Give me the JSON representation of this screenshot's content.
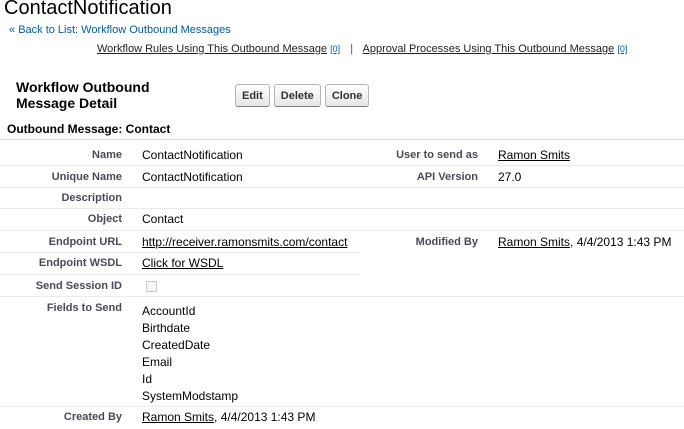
{
  "page": {
    "title": "ContactNotification",
    "back_prefix": "«",
    "back_link": "Back to List: Workflow Outbound Messages"
  },
  "related": {
    "workflow_rules_label": "Workflow Rules Using This Outbound Message",
    "workflow_rules_count": "[0]",
    "separator": "|",
    "approval_label": "Approval Processes Using This Outbound Message",
    "approval_count": "[0]"
  },
  "detail": {
    "header": "Workflow Outbound Message Detail",
    "buttons": {
      "edit": "Edit",
      "delete": "Delete",
      "clone": "Clone"
    },
    "section_title": "Outbound Message: Contact"
  },
  "fields": {
    "name_label": "Name",
    "name_value": "ContactNotification",
    "unique_name_label": "Unique Name",
    "unique_name_value": "ContactNotification",
    "description_label": "Description",
    "description_value": "",
    "object_label": "Object",
    "object_value": "Contact",
    "endpoint_url_label": "Endpoint URL",
    "endpoint_url_value": "http://receiver.ramonsmits.com/contact",
    "endpoint_wsdl_label": "Endpoint WSDL",
    "endpoint_wsdl_value": "Click for WSDL",
    "send_session_id_label": "Send Session ID",
    "send_session_id_checked": false,
    "fields_to_send_label": "Fields to Send",
    "fields_to_send": [
      "AccountId",
      "Birthdate",
      "CreatedDate",
      "Email",
      "Id",
      "SystemModstamp"
    ],
    "created_by_label": "Created By",
    "created_by_user": "Ramon Smits",
    "created_by_date": ", 4/4/2013 1:43 PM",
    "user_to_send_as_label": "User to send as",
    "user_to_send_as_value": "Ramon Smits",
    "api_version_label": "API Version",
    "api_version_value": "27.0",
    "modified_by_label": "Modified By",
    "modified_by_user": "Ramon Smits",
    "modified_by_date": ", 4/4/2013 1:43 PM"
  }
}
